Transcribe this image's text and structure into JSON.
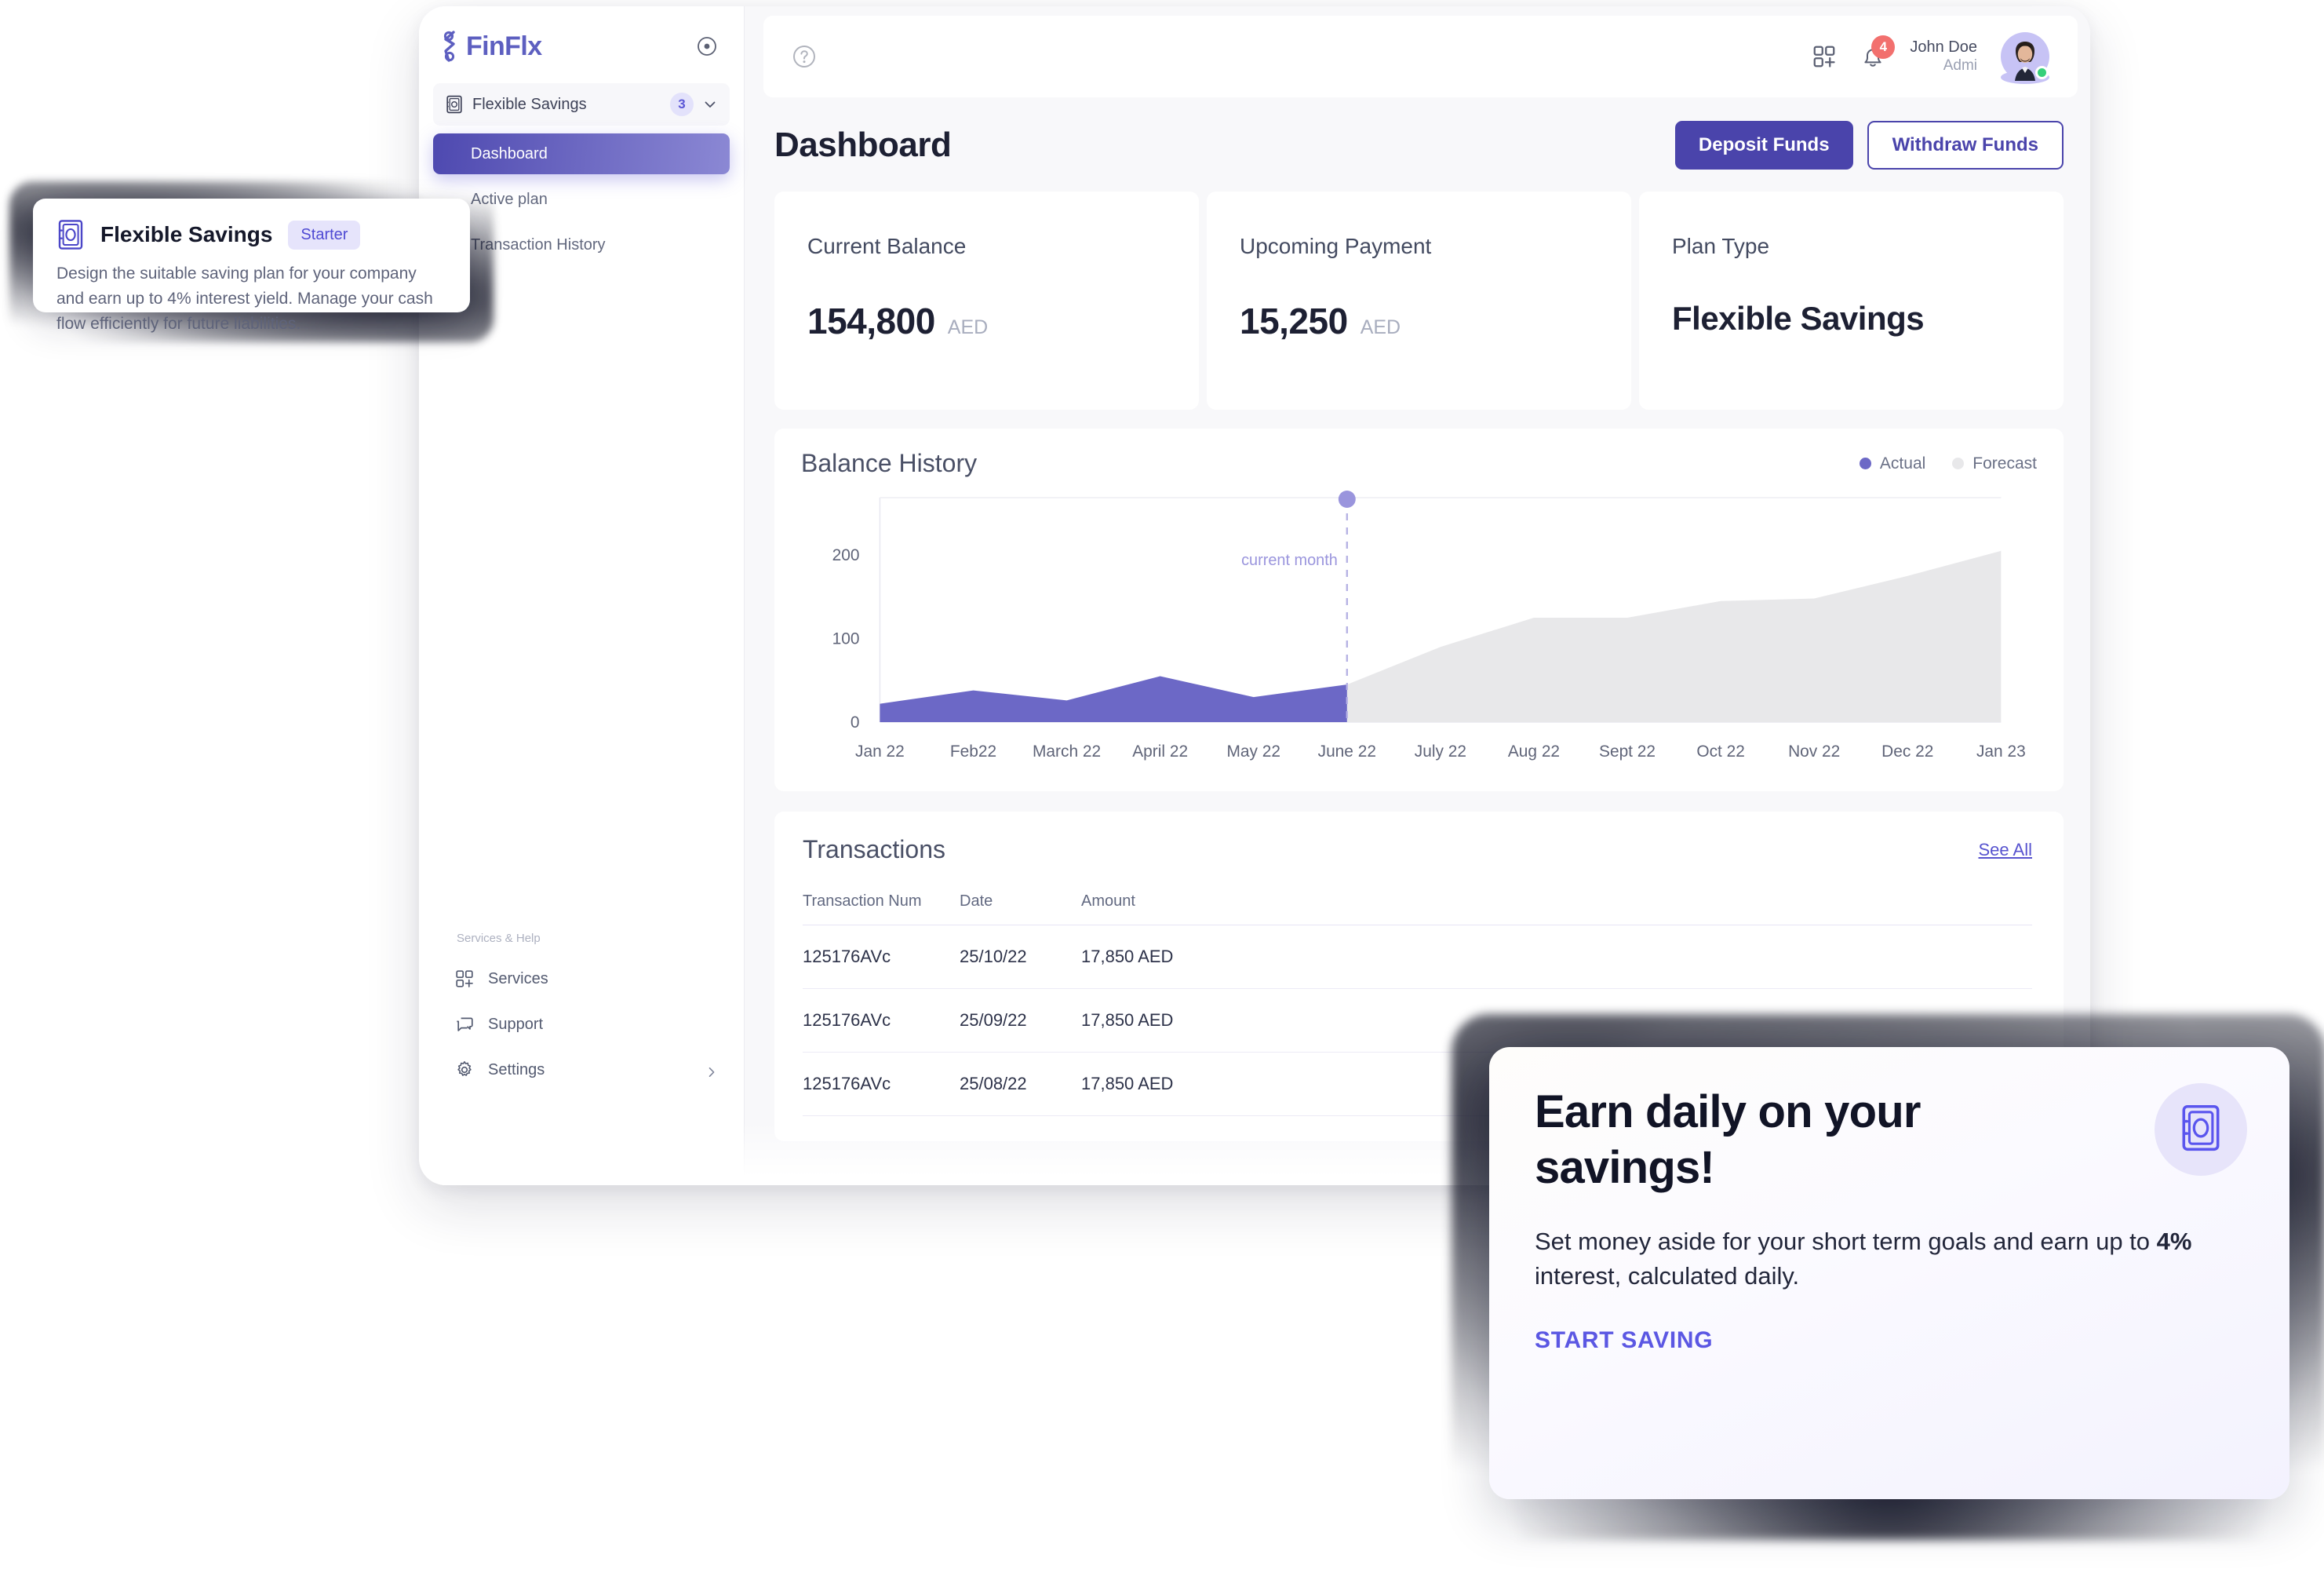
{
  "brand": {
    "name": "FinFlx",
    "logo_icon": "finflx-logo-mark",
    "collapse_icon": "collapse-circle-icon"
  },
  "sidebar": {
    "plan_selector": {
      "label": "Flexible Savings",
      "count": "3",
      "icon": "safe-icon",
      "chevron": "chevron-down-icon"
    },
    "nav": [
      {
        "label": "Dashboard",
        "active": true
      },
      {
        "label": "Active plan",
        "active": false
      },
      {
        "label": "Transaction History",
        "active": false
      }
    ],
    "services_title": "Services & Help",
    "services": [
      {
        "label": "Services",
        "icon": "apps-add-icon",
        "arrow": false
      },
      {
        "label": "Support",
        "icon": "chat-bubbles-icon",
        "arrow": false
      },
      {
        "label": "Settings",
        "icon": "gear-icon",
        "arrow": true
      }
    ]
  },
  "topbar": {
    "help_icon": "question-circle-icon",
    "grid_icon": "apps-add-icon",
    "bell_icon": "bell-icon",
    "notification_count": "4",
    "user_name": "John Doe",
    "user_role": "Admi",
    "status": "online"
  },
  "page": {
    "title": "Dashboard",
    "deposit_label": "Deposit Funds",
    "withdraw_label": "Withdraw Funds"
  },
  "stats": [
    {
      "label": "Current Balance",
      "value": "154,800",
      "unit": "AED",
      "is_text": false
    },
    {
      "label": "Upcoming Payment",
      "value": "15,250",
      "unit": "AED",
      "is_text": false
    },
    {
      "label": "Plan Type",
      "value": "Flexible Savings",
      "unit": "",
      "is_text": true
    }
  ],
  "chart_card": {
    "title": "Balance History",
    "legend": [
      {
        "label": "Actual",
        "color": "#6c68c6"
      },
      {
        "label": "Forecast",
        "color": "#e8e8ea"
      }
    ]
  },
  "chart_data": {
    "type": "area",
    "title": "Balance History",
    "xlabel": "",
    "ylabel": "",
    "ylim": [
      0,
      250
    ],
    "yticks": [
      0,
      100,
      200
    ],
    "grid": false,
    "legend_position": "top-right",
    "annotation": {
      "label": "current month",
      "at_category": "June 22",
      "color": "#9a95dd"
    },
    "categories": [
      "Jan 22",
      "Feb22",
      "March 22",
      "April 22",
      "May 22",
      "June 22",
      "July 22",
      "Aug 22",
      "Sept 22",
      "Oct 22",
      "Nov 22",
      "Dec 22",
      "Jan 23"
    ],
    "series": [
      {
        "name": "Actual",
        "color": "#6c68c6",
        "values": [
          22,
          38,
          26,
          55,
          30,
          45,
          null,
          null,
          null,
          null,
          null,
          null,
          null
        ]
      },
      {
        "name": "Forecast",
        "color": "#e8e8ea",
        "values": [
          null,
          null,
          null,
          null,
          null,
          45,
          90,
          125,
          125,
          145,
          148,
          175,
          205
        ]
      }
    ]
  },
  "transactions": {
    "title": "Transactions",
    "see_all": "See All",
    "columns": [
      "Transaction Num",
      "Date",
      "Amount"
    ],
    "rows": [
      {
        "num": "125176AVc",
        "date": "25/10/22",
        "amount": "17,850 AED"
      },
      {
        "num": "125176AVc",
        "date": "25/09/22",
        "amount": "17,850 AED"
      },
      {
        "num": "125176AVc",
        "date": "25/08/22",
        "amount": "17,850 AED"
      }
    ]
  },
  "plan_popup": {
    "icon": "safe-icon",
    "title": "Flexible Savings",
    "badge": "Starter",
    "body": "Design the suitable saving plan for your company and earn up to 4% interest yield. Manage your cash flow efficiently for future liabilities."
  },
  "promo": {
    "title": "Earn daily on your savings!",
    "body_before": "Set money aside for your short term goals and earn up to ",
    "body_bold": "4%",
    "body_after": " interest, calculated daily.",
    "cta": "START SAVING",
    "icon": "safe-icon"
  },
  "colors": {
    "brand_purple": "#5d5fc0",
    "accent_indigo": "#4a44ab",
    "actual_series": "#6c68c6",
    "forecast_series": "#e8e8ea",
    "badge_red": "#f2706e",
    "online_green": "#36d07a"
  }
}
